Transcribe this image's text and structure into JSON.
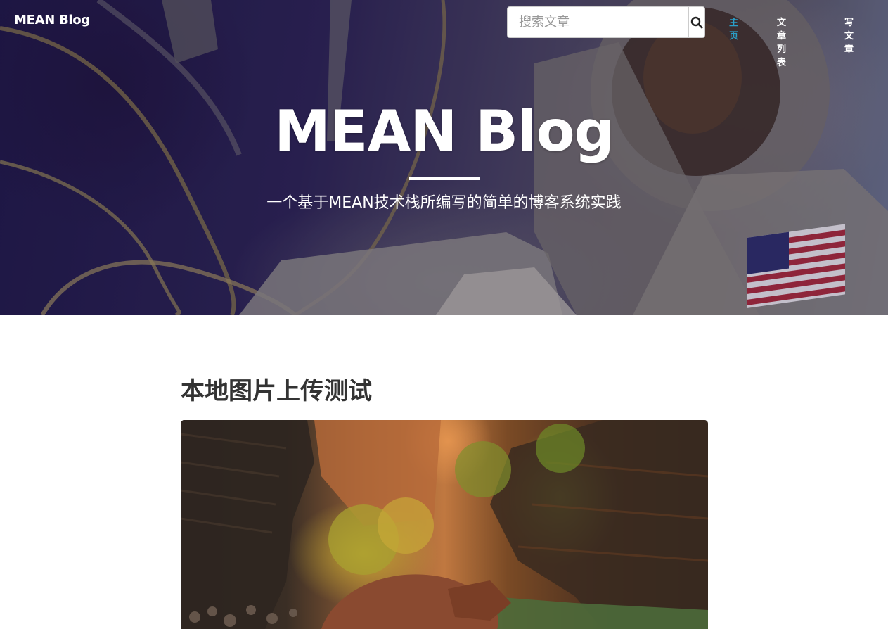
{
  "navbar": {
    "brand": "MEAN Blog",
    "search": {
      "placeholder": "搜索文章"
    },
    "links": [
      {
        "label": "主页",
        "active": true
      },
      {
        "label": "文章列表",
        "active": false
      },
      {
        "label": "写文章",
        "active": false
      }
    ]
  },
  "hero": {
    "title": "MEAN Blog",
    "subtitle": "一个基于MEAN技术栈所编写的简单的博客系统实践"
  },
  "post": {
    "title": "本地图片上传测试"
  },
  "colors": {
    "accent": "#2a9fc8",
    "heading": "#333333",
    "hero_text": "#ffffff"
  },
  "icons": {
    "search_button": "search-icon"
  }
}
